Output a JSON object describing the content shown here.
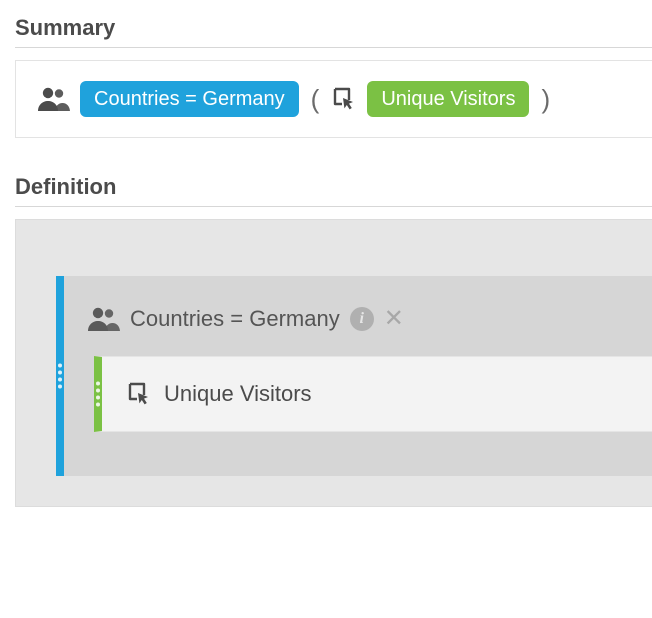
{
  "sections": {
    "summary_title": "Summary",
    "definition_title": "Definition"
  },
  "summary": {
    "segment_label": "Countries = Germany",
    "paren_open": "(",
    "paren_close": ")",
    "metric_label": "Unique Visitors"
  },
  "definition": {
    "segment": {
      "label": "Countries = Germany"
    },
    "metric": {
      "label": "Unique Visitors"
    }
  },
  "icons": {
    "people": "people-icon",
    "cursor_click": "cursor-click-icon",
    "info": "i",
    "close": "✕"
  },
  "colors": {
    "blue": "#1fa2dc",
    "green": "#7bc144"
  }
}
